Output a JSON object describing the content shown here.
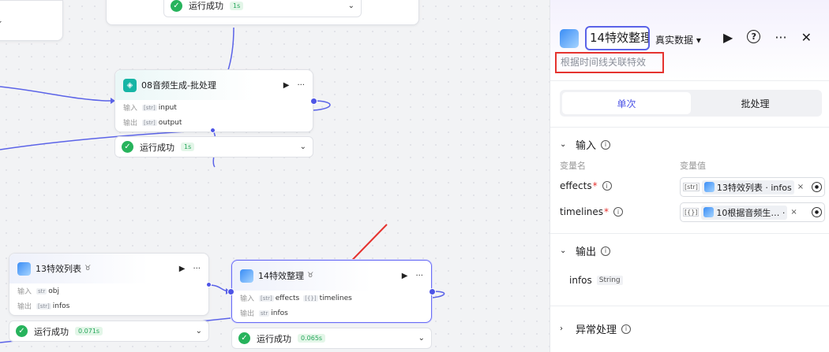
{
  "nodes": {
    "top": {
      "status": "运行成功",
      "duration": "1s"
    },
    "audio": {
      "title": "08音频生成-批处理",
      "input_label": "输入",
      "input_var": "input",
      "input_type": "[str]",
      "output_label": "输出",
      "output_var": "output",
      "output_type": "[str]",
      "status": "运行成功",
      "duration": "1s"
    },
    "effects_list": {
      "title": "13特效列表",
      "input_label": "输入",
      "input_var": "obj",
      "input_type": "str",
      "output_label": "输出",
      "output_var": "infos",
      "output_type": "[str]",
      "status": "运行成功",
      "duration": "0.071s"
    },
    "effects_sort": {
      "title": "14特效整理",
      "input_label": "输入",
      "input_var1": "effects",
      "input_type1": "[str]",
      "input_var2": "timelines",
      "input_type2": "[{}]",
      "output_label": "输出",
      "output_var": "infos",
      "output_type": "str",
      "status": "运行成功",
      "duration": "0.065s"
    }
  },
  "panel": {
    "name": "14特效整理",
    "data_mode": "真实数据",
    "description": "根据时间线关联特效",
    "tabs": [
      {
        "label": "单次",
        "active": true
      },
      {
        "label": "批处理",
        "active": false
      }
    ],
    "input_section": "输入",
    "col_name": "变量名",
    "col_value": "变量值",
    "inputs": [
      {
        "name": "effects",
        "type": "[str]",
        "value": "13特效列表 · infos"
      },
      {
        "name": "timelines",
        "type": "[{}]",
        "value": "10根据音频生…  ·"
      }
    ],
    "output_section": "输出",
    "outputs": [
      {
        "name": "infos",
        "type": "String"
      }
    ],
    "error_section": "异常处理"
  },
  "colors": {
    "accent": "#4e55e6",
    "success": "#27b35c",
    "annotation": "#e5332f"
  }
}
